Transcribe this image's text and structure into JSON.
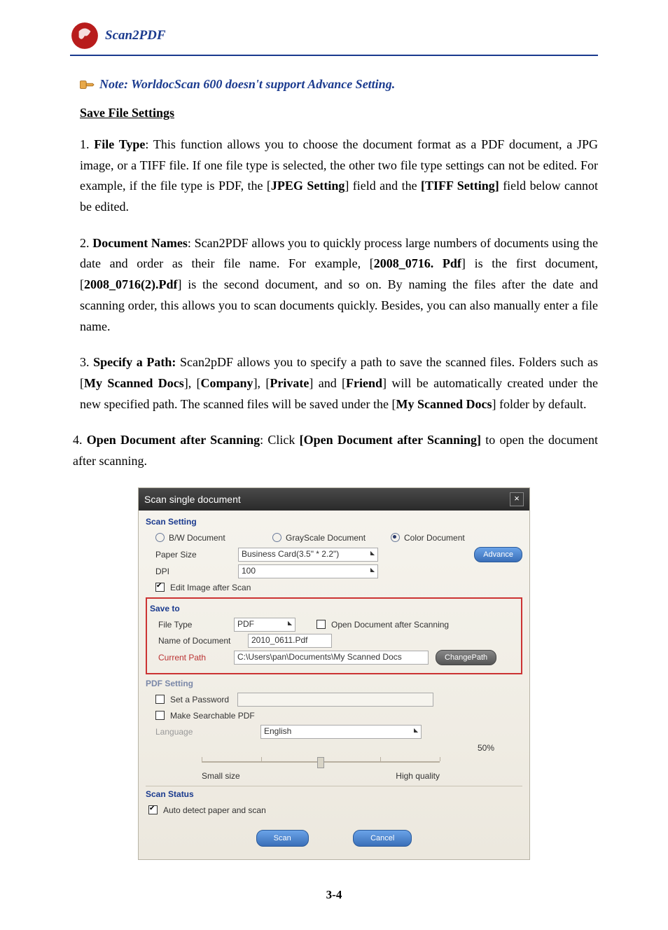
{
  "header": {
    "product": "Scan2PDF"
  },
  "note": "Note: WorldocScan 600 doesn't support Advance Setting.",
  "section_title": "Save File Settings",
  "items": {
    "i1": {
      "num": "1.",
      "lead": "File Type",
      "text1": ": This function allows you to choose the document format as a PDF document, a JPG image, or a TIFF file. If one file type is selected, the other two file type settings can not be edited. For example, if the file type is PDF, the [",
      "bold1": "JPEG Setting",
      "text2": "] field and the ",
      "bold2": "[TIFF Setting]",
      "text3": " field below cannot be edited."
    },
    "i2": {
      "num": "2.",
      "lead": "Document Names",
      "text1": ": Scan2PDF allows you to quickly process large numbers of documents using the date and order as their file name. For example, [",
      "bold1": "2008_0716. Pdf",
      "text2": "] is the first document, [",
      "bold2": "2008_0716(2).Pdf",
      "text3": "] is the second document, and so on. By naming the files after the date and scanning order, this allows you to scan documents quickly. Besides, you can also manually enter a file name."
    },
    "i3": {
      "num": "3.",
      "lead": "Specify a Path:",
      "text1": " Scan2pDF allows you to specify a path to save the scanned files. Folders such as  [",
      "bold1": "My Scanned Docs",
      "text2": "], [",
      "bold2": "Company",
      "text3": "], [",
      "bold3": "Private",
      "text4": "] and [",
      "bold4": "Friend",
      "text5": "] will be automatically created under the new specified path. The scanned files will be saved under the [",
      "bold5": "My Scanned Docs",
      "text6": "] folder  by default."
    },
    "i4": {
      "num": "4.",
      "lead": "Open Document after Scanning",
      "text1": ": Click ",
      "bold1": "[Open Document after Scanning]",
      "text2": " to open the document after scanning."
    }
  },
  "dialog": {
    "title": "Scan single document",
    "scan_setting": "Scan Setting",
    "bw": "B/W Document",
    "gray": "GrayScale Document",
    "color": "Color Document",
    "paper_size_lbl": "Paper Size",
    "paper_size_val": "Business Card(3.5\" * 2.2\")",
    "advance": "Advance",
    "dpi_lbl": "DPI",
    "dpi_val": "100",
    "edit_after": "Edit Image after Scan",
    "save_to": "Save to",
    "file_type_lbl": "File Type",
    "file_type_val": "PDF",
    "open_after": "Open Document after Scanning",
    "doc_name_lbl": "Name of Document",
    "doc_name_val": "2010_0611.Pdf",
    "path_lbl": "Current Path",
    "path_val": "C:\\Users\\pan\\Documents\\My Scanned Docs",
    "change_path": "ChangePath",
    "pdf_setting": "PDF Setting",
    "set_pwd": "Set a Password",
    "searchable": "Make Searchable PDF",
    "lang_lbl": "Language",
    "lang_val": "English",
    "percent": "50%",
    "small": "Small size",
    "high": "High quality",
    "scan_status": "Scan Status",
    "auto_detect": "Auto detect paper and scan",
    "scan_btn": "Scan",
    "cancel_btn": "Cancel"
  },
  "page_num": "3-4"
}
